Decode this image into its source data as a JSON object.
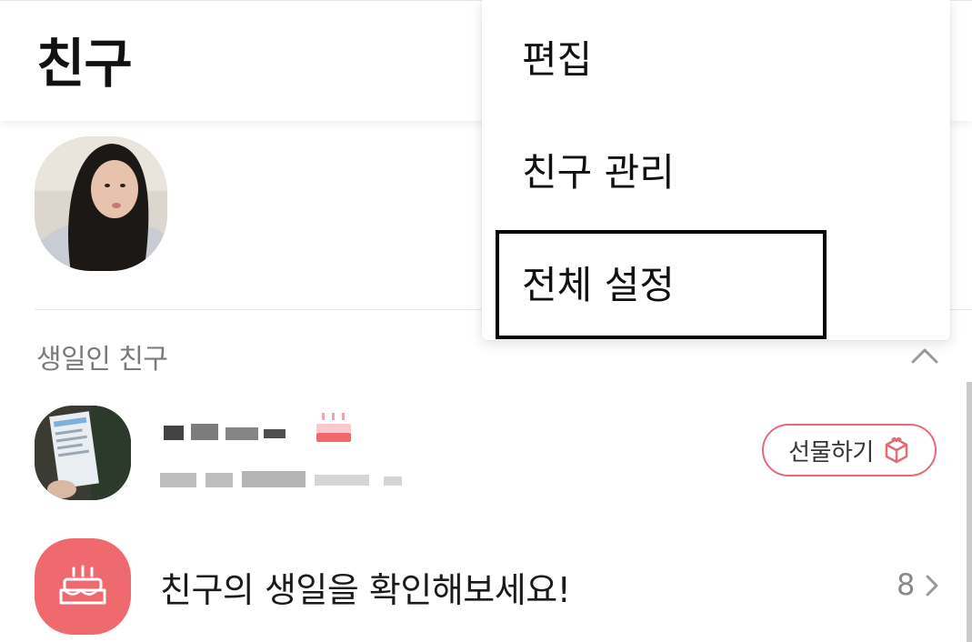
{
  "header": {
    "title": "친구"
  },
  "menu": {
    "items": [
      {
        "label": "편집"
      },
      {
        "label": "친구 관리"
      },
      {
        "label": "전체 설정"
      }
    ],
    "highlighted_index": 2
  },
  "birthday_section": {
    "label": "생일인 친구",
    "gift_button_label": "선물하기",
    "check_text": "친구의 생일을 확인해보세요!",
    "count": "8"
  },
  "colors": {
    "accent": "#ef6a6f",
    "gift_border": "#e46b73"
  }
}
